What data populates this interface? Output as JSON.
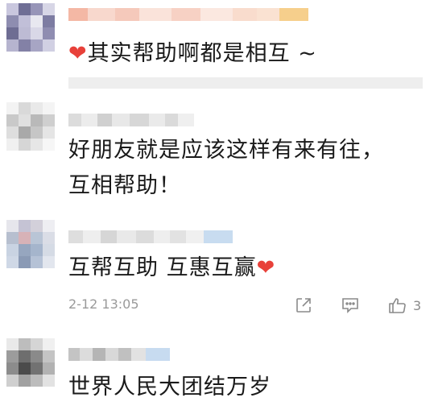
{
  "comments": [
    {
      "text": "其实帮助啊都是相互 ~",
      "heart_position": "before"
    },
    {
      "text_line1": "好朋友就是应该这样有来有往，",
      "text_line2": "互相帮助！"
    },
    {
      "text": "互帮互助  互惠互赢",
      "heart_position": "after",
      "timestamp": "2-12 13:05",
      "like_count": "3"
    },
    {
      "text": "世界人民大团结万岁"
    }
  ],
  "heart_glyph": "❤",
  "colors": {
    "heart": "#e8413a",
    "meta_text": "#9a9a9a",
    "icon": "#8a8a8a"
  },
  "icons": [
    "share-icon",
    "comment-icon",
    "like-icon"
  ]
}
